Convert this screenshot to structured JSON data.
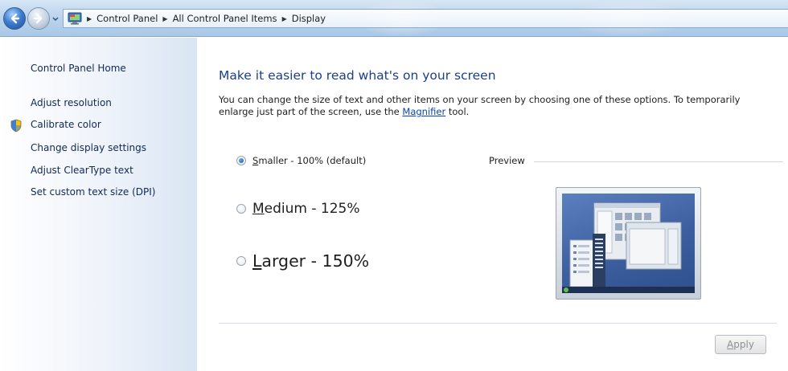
{
  "breadcrumb": {
    "items": [
      "Control Panel",
      "All Control Panel Items",
      "Display"
    ]
  },
  "sidebar": {
    "home": "Control Panel Home",
    "items": [
      {
        "label": "Adjust resolution"
      },
      {
        "label": "Calibrate color",
        "icon": "uac-shield-icon"
      },
      {
        "label": "Change display settings"
      },
      {
        "label": "Adjust ClearType text"
      },
      {
        "label": "Set custom text size (DPI)"
      }
    ]
  },
  "main": {
    "title": "Make it easier to read what's on your screen",
    "description_before": "You can change the size of text and other items on your screen by choosing one of these options. To temporarily enlarge just part of the screen, use the ",
    "description_link": "Magnifier",
    "description_after": " tool.",
    "options": [
      {
        "access_key": "S",
        "label_rest": "maller - 100% (default)",
        "selected": true
      },
      {
        "access_key": "M",
        "label_rest": "edium - 125%",
        "selected": false
      },
      {
        "access_key": "L",
        "label_rest": "arger - 150%",
        "selected": false
      }
    ],
    "preview_label": "Preview",
    "apply": {
      "access_key": "A",
      "label_rest": "pply",
      "enabled": false
    }
  },
  "colors": {
    "title": "#1b3f8a",
    "nav_text": "#0f2a54",
    "link": "#0645ad"
  }
}
